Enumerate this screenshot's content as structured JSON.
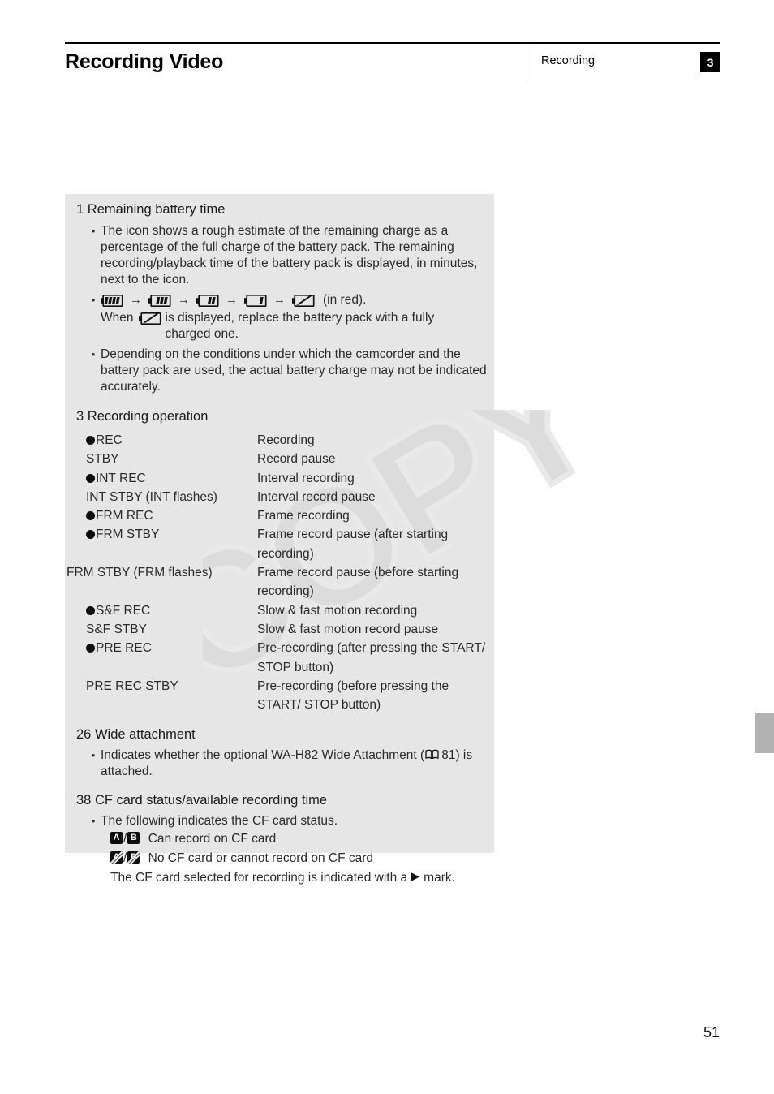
{
  "header": {
    "title": "Recording Video",
    "section": "Recording",
    "chapter": "3"
  },
  "sections": [
    {
      "number": "1",
      "title": "Remaining battery time",
      "bullets": [
        "The icon shows a rough estimate of the remaining charge as a percentage of the full charge of the battery pack. The remaining recording/playback time of the battery pack is displayed, in minutes, next to the icon.",
        "Depending on the conditions under which the camcorder and the battery pack are used, the actual battery charge may not be indicated accurately."
      ],
      "battery_sequence": {
        "levels": [
          4,
          3,
          2,
          1,
          0
        ],
        "arrow": "→",
        "trailing_text": "(in red).",
        "note_before": "When",
        "note_after": "is displayed, replace the battery pack with a fully charged one."
      }
    },
    {
      "number": "3",
      "title": "Recording operation",
      "rows": [
        {
          "dot": true,
          "indicator": "REC",
          "meaning": "Recording"
        },
        {
          "dot": false,
          "indicator": "STBY",
          "meaning": "Record pause"
        },
        {
          "dot": true,
          "indicator": "INT REC",
          "meaning": "Interval recording"
        },
        {
          "dot": false,
          "indicator": "INT STBY (INT flashes)",
          "meaning": "Interval record pause"
        },
        {
          "dot": true,
          "indicator": "FRM REC",
          "meaning": "Frame recording"
        },
        {
          "dot": true,
          "indicator": "FRM STBY",
          "meaning": "Frame record pause (after starting recording)"
        },
        {
          "dot": false,
          "indicator": "FRM STBY (FRM flashes)",
          "meaning": "Frame record pause (before starting recording)",
          "wide": true
        },
        {
          "dot": true,
          "indicator": "S&F REC",
          "meaning": "Slow & fast motion recording"
        },
        {
          "dot": false,
          "indicator": "S&F STBY",
          "meaning": "Slow & fast motion record pause"
        },
        {
          "dot": true,
          "indicator": "PRE REC",
          "meaning": "Pre-recording (after pressing the START/ STOP button)"
        },
        {
          "dot": false,
          "indicator": "PRE REC STBY",
          "meaning": "Pre-recording (before pressing the START/ STOP button)"
        }
      ]
    },
    {
      "number": "26",
      "title": "Wide attachment",
      "reference": {
        "text_before": "Indicates whether the optional WA-H82 Wide Attachment (",
        "page_ref": "81",
        "text_after": ") is attached."
      }
    },
    {
      "number": "38",
      "title": "CF card status/available recording time",
      "bullet": "The following indicates the CF card status.",
      "card_states": [
        {
          "badges": [
            "A",
            "B"
          ],
          "slashed": false,
          "meaning": "Can record on CF card"
        },
        {
          "badges": [
            "A",
            "B"
          ],
          "slashed": true,
          "meaning": "No CF card or cannot record on CF card"
        }
      ],
      "footnote_before": "The CF card selected for recording is indicated with a",
      "footnote_after": "mark."
    }
  ],
  "watermark": "COPY",
  "page_number": "51",
  "colors": {
    "panel_background": "#e6e6e6",
    "page_background": "#ffffff",
    "text": "#2b2b2b",
    "badge_black": "#0d0d0d",
    "side_tab": "#b2b2b2",
    "watermark": "#d9d9d9"
  }
}
